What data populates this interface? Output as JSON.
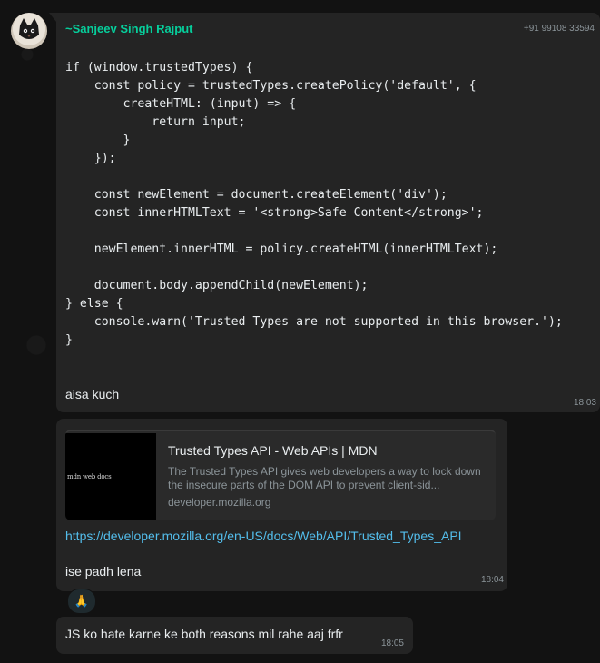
{
  "message_group": {
    "sender_name": "~Sanjeev Singh Rajput",
    "sender_phone": "+91 99108 33594",
    "sender_color": "#06cf9c"
  },
  "messages": [
    {
      "code": "if (window.trustedTypes) {\n    const policy = trustedTypes.createPolicy('default', {\n        createHTML: (input) => {\n            return input;\n        }\n    });\n\n    const newElement = document.createElement('div');\n    const innerHTMLText = '<strong>Safe Content</strong>';\n\n    newElement.innerHTML = policy.createHTML(innerHTMLText);\n\n    document.body.appendChild(newElement);\n} else {\n    console.warn('Trusted Types are not supported in this browser.');\n}",
      "text": "aisa kuch",
      "time": "18:03"
    },
    {
      "link_preview": {
        "thumb_text": "mdn web docs_",
        "title": "Trusted Types API - Web APIs | MDN",
        "description": "The Trusted Types API gives web developers a way to lock down the insecure parts of the DOM API to prevent client-sid...",
        "domain": "developer.mozilla.org"
      },
      "link_url": "https://developer.mozilla.org/en-US/docs/Web/API/Trusted_Types_API",
      "text": "ise padh lena",
      "time": "18:04",
      "reaction": "🙏"
    },
    {
      "text": "JS ko hate karne ke both reasons mil rahe aaj frfr",
      "time": "18:05"
    }
  ],
  "colors": {
    "background": "#121212",
    "bubble": "#242424",
    "link": "#53bdeb",
    "meta_text": "#8b9499"
  }
}
